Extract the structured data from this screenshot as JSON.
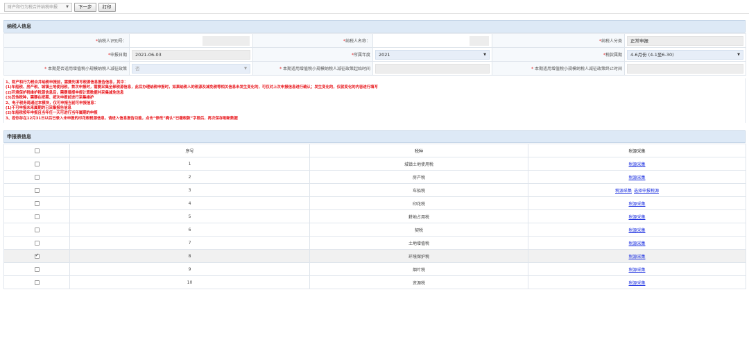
{
  "toolbar": {
    "module_select": "财产和行为税合并纳税申报",
    "next_button": "下一步",
    "print_button": "打印"
  },
  "taxpayer_section": {
    "title": "纳税人信息",
    "taxpayer_id": {
      "label": "纳税人识别号：",
      "value": ""
    },
    "taxpayer_name": {
      "label": "纳税人名称：",
      "value": ""
    },
    "taxpayer_category": {
      "label": "纳税人分类",
      "value": "正常申报"
    },
    "declare_date": {
      "label": "申报日期",
      "value": "2021-06-03"
    },
    "year": {
      "label": "所属年度",
      "value": "2021"
    },
    "tax_period": {
      "label": "税款属期",
      "value": "4-6月份 (4-1至6-30)"
    },
    "small_scale_policy": {
      "label": "本期是否适用增值税小规模纳税人减征政策",
      "value": "否"
    },
    "policy_start": {
      "label": "本期适用增值税小规模纳税人减征政策起始时间",
      "value": ""
    },
    "policy_end": {
      "label": "本期适用增值税小规模纳税人减征政策终止时间",
      "value": ""
    }
  },
  "notice": [
    "1、财产和行为税合并纳税申报前，需要先填写税源信息报告信息，其中：",
    "(1)车船税、房产税、城镇土地使用税，首次申报时，需要采集全部税源信息，此后办理纳税申报时，如果纳税人的税源及减免税等相关信息未发生变化的，可仅对上次申报信息进行确认；发生变化的，仅就变化的内容进行填写",
    "(2)环境保护税维护税源信息后，需要填报申报计算数据并采集减免信息",
    "(3)其他税种，需要在按期、按次申报前进行采集维护",
    "2、电子税务局通过本模块，仅可申报当前可申报信息：",
    "(1)不可申报未来属期的已采集报告信息",
    "(2)车船税按年申报且当年任一天可进行当年属期的申报",
    "3、若你存在12月31日以后已录入未申报的印花税税源信息，请进入信息报告功能，点击“修改”确认“已缴税款”字段后，再次保存刷新数据"
  ],
  "declaration_section": {
    "title": "申报表信息",
    "columns": [
      "序号",
      "税种",
      "税源采集"
    ],
    "rows": [
      {
        "checked": false,
        "no": "1",
        "tax": "城镇土地使用税",
        "links": [
          "税源采集"
        ]
      },
      {
        "checked": false,
        "no": "2",
        "tax": "房产税",
        "links": [
          "税源采集"
        ]
      },
      {
        "checked": false,
        "no": "3",
        "tax": "车船税",
        "links": [
          "税源采集",
          "选择申报税源"
        ]
      },
      {
        "checked": false,
        "no": "4",
        "tax": "印花税",
        "links": [
          "税源采集"
        ]
      },
      {
        "checked": false,
        "no": "5",
        "tax": "耕地占用税",
        "links": [
          "税源采集"
        ]
      },
      {
        "checked": false,
        "no": "6",
        "tax": "契税",
        "links": [
          "税源采集"
        ]
      },
      {
        "checked": false,
        "no": "7",
        "tax": "土地增值税",
        "links": [
          "税源采集"
        ]
      },
      {
        "checked": true,
        "no": "8",
        "tax": "环境保护税",
        "links": [
          "税源采集"
        ]
      },
      {
        "checked": false,
        "no": "9",
        "tax": "烟叶税",
        "links": [
          "税源采集"
        ]
      },
      {
        "checked": false,
        "no": "10",
        "tax": "资源税",
        "links": [
          "税源采集"
        ]
      }
    ]
  }
}
